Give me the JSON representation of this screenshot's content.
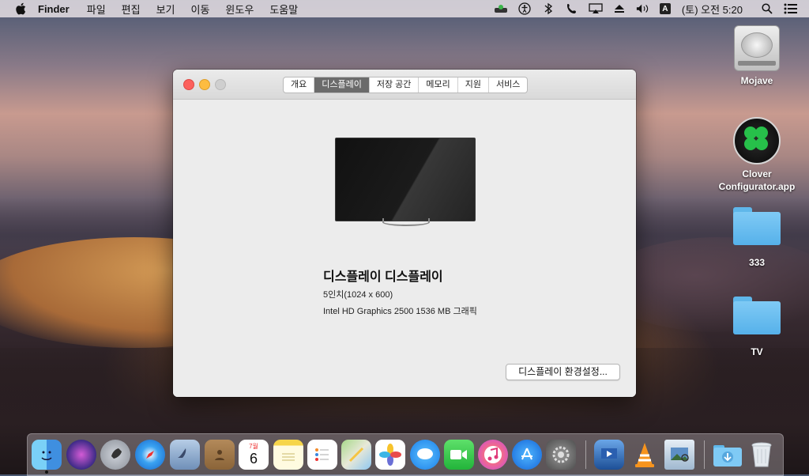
{
  "menubar": {
    "app_name": "Finder",
    "items": [
      "파일",
      "편집",
      "보기",
      "이동",
      "윈도우",
      "도움말"
    ],
    "input_source": "A",
    "clock": "(토) 오전 5:20"
  },
  "desktop": {
    "icons": [
      {
        "label": "Mojave",
        "kind": "hard-drive-icon"
      },
      {
        "label": "Clover\nConfigurator.app",
        "label_line1": "Clover",
        "label_line2": "Configurator.app",
        "kind": "clover-app-icon"
      },
      {
        "label": "333",
        "kind": "folder-icon"
      },
      {
        "label": "TV",
        "kind": "folder-icon"
      }
    ]
  },
  "window": {
    "tabs": [
      {
        "label": "개요",
        "active": false
      },
      {
        "label": "디스플레이",
        "active": true
      },
      {
        "label": "저장 공간",
        "active": false
      },
      {
        "label": "메모리",
        "active": false
      },
      {
        "label": "지원",
        "active": false
      },
      {
        "label": "서비스",
        "active": false
      }
    ],
    "display": {
      "title": "디스플레이 디스플레이",
      "resolution": "5인치(1024 x 600)",
      "graphics": "Intel HD Graphics 2500 1536 MB 그래픽"
    },
    "preferences_button": "디스플레이 환경설정..."
  },
  "dock": {
    "calendar_month": "7월",
    "calendar_day": "6",
    "apps": [
      "finder-icon",
      "siri-icon",
      "launchpad-icon",
      "safari-icon",
      "mail-icon",
      "contacts-icon",
      "calendar-icon",
      "notes-icon",
      "reminders-icon",
      "maps-icon",
      "photos-icon",
      "messages-icon",
      "facetime-icon",
      "itunes-icon",
      "app-store-icon",
      "system-preferences-icon",
      "keynote-icon",
      "vlc-icon",
      "preview-icon",
      "downloads-folder-icon",
      "trash-icon"
    ]
  }
}
